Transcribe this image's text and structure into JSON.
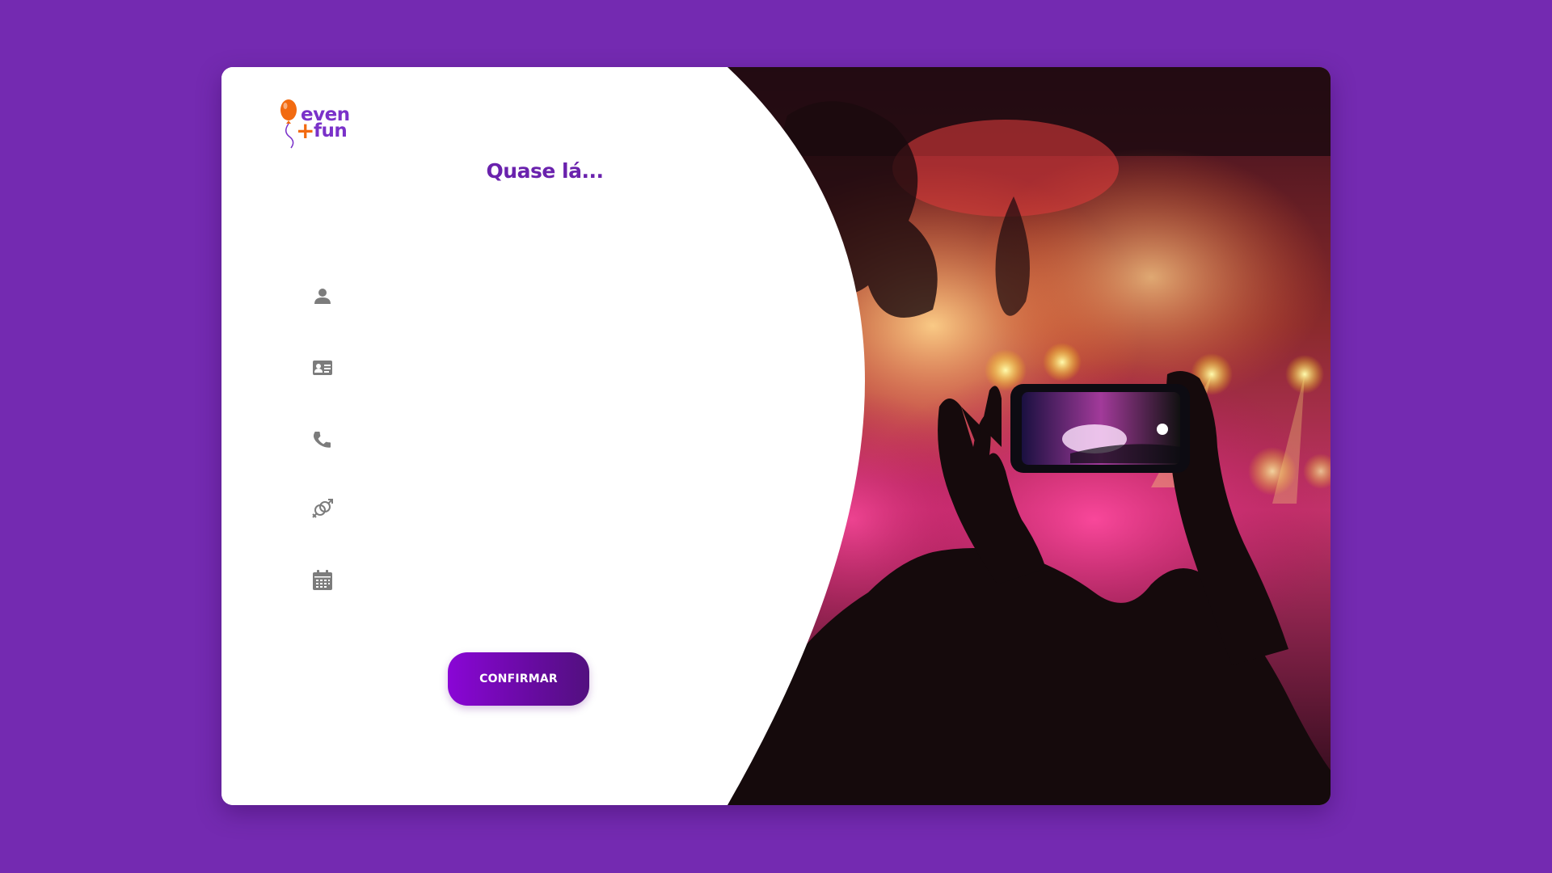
{
  "brand": {
    "line1": "even",
    "plus": "+",
    "line2": "fun",
    "logo_icon": "balloon-icon",
    "primary_color": "#742ab1",
    "accent_color": "#f26a10"
  },
  "form": {
    "title": "Quase lá...",
    "fields": [
      {
        "icon": "person-icon",
        "placeholder": "",
        "value": ""
      },
      {
        "icon": "id-card-icon",
        "placeholder": "",
        "value": ""
      },
      {
        "icon": "phone-icon",
        "placeholder": "",
        "value": ""
      },
      {
        "icon": "gender-icon",
        "placeholder": "",
        "value": ""
      },
      {
        "icon": "calendar-icon",
        "placeholder": "",
        "value": ""
      }
    ],
    "submit_label": "CONFIRMAR"
  },
  "hero": {
    "image": "concert-crowd-phone-photo"
  }
}
